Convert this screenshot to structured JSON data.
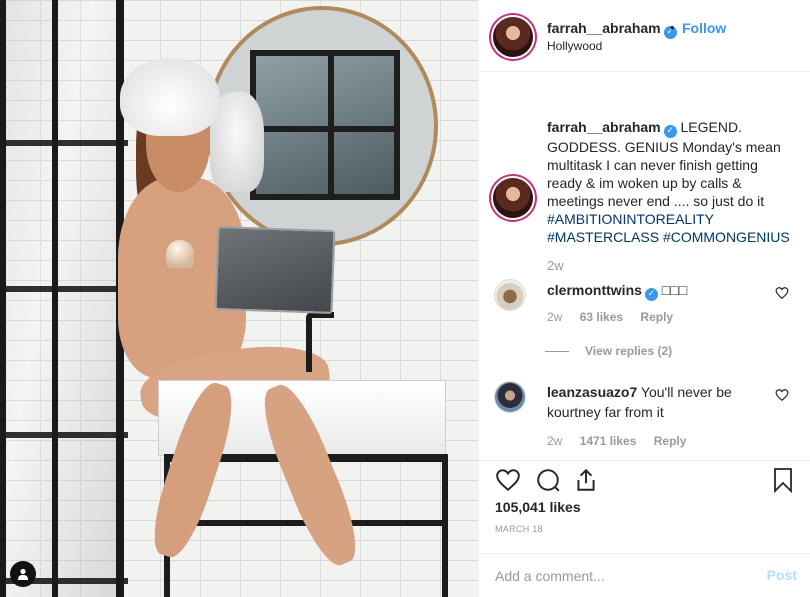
{
  "post": {
    "image_alt": "",
    "user_tag_icon": "person-icon"
  },
  "header": {
    "username": "farrah__abraham",
    "verified_icon": "verified-check-icon",
    "separator": "•",
    "follow_label": "Follow",
    "location": "Hollywood"
  },
  "caption": {
    "username": "farrah__abraham",
    "text": "LEGEND. GODDESS. GENIUS Monday's mean multitask I can never finish getting ready & im woken up by calls & meetings never end .... so just do it",
    "hashtags": [
      "#AMBITIONINTOREALITY",
      "#MASTERCLASS",
      "#COMMONGENIUS"
    ],
    "time": "2w"
  },
  "comments": [
    {
      "username": "clermonttwins",
      "text": "□□□",
      "time": "2w",
      "likes": "63 likes",
      "reply_label": "Reply"
    },
    {
      "username": "leanzasuazo7",
      "text": "You'll never be kourtney far from it",
      "time": "2w",
      "likes": "1471 likes",
      "reply_label": "Reply"
    }
  ],
  "view_replies_label": "View replies (2)",
  "actions": {
    "likes_count": "105,041 likes",
    "date": "MARCH 18",
    "comment_placeholder": "Add a comment...",
    "post_label": "Post"
  },
  "colors": {
    "link_blue": "#3897f0",
    "hashtag_blue": "#003569",
    "muted_gray": "#999999",
    "post_disabled": "#b2dffc"
  }
}
